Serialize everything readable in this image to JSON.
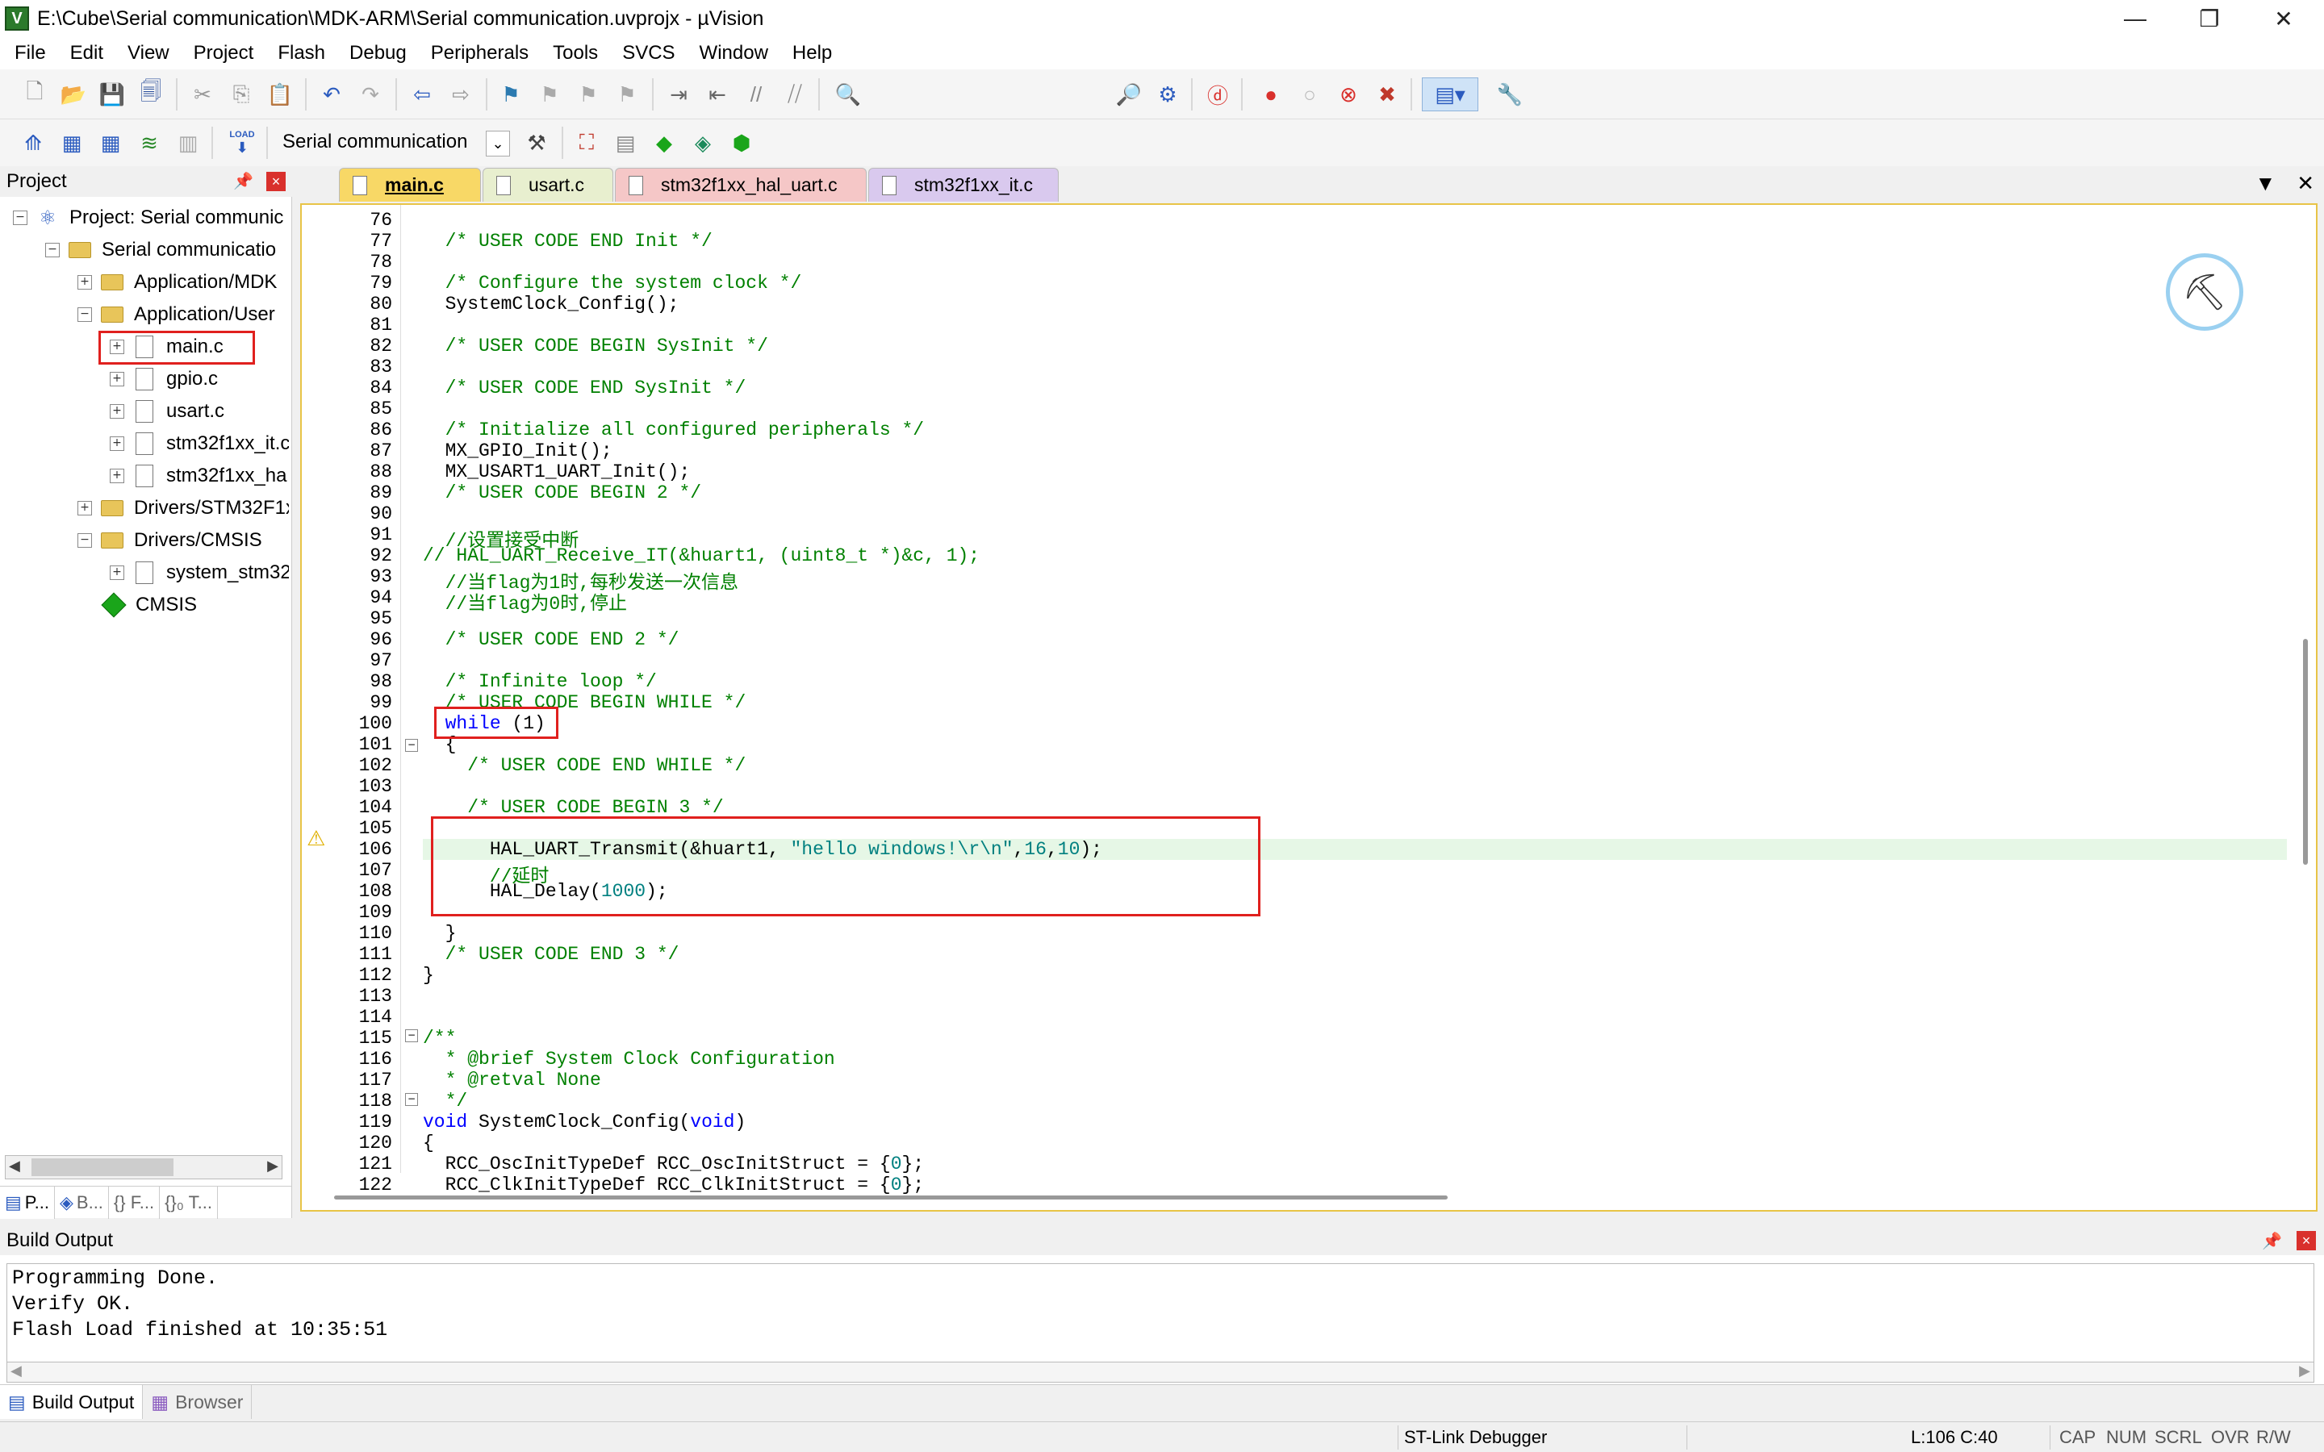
{
  "window": {
    "title": "E:\\Cube\\Serial communication\\MDK-ARM\\Serial communication.uvprojx - µVision",
    "app_icon": "V",
    "controls": {
      "minimize": "—",
      "restore": "❐",
      "close": "✕"
    }
  },
  "menu": [
    "File",
    "Edit",
    "View",
    "Project",
    "Flash",
    "Debug",
    "Peripherals",
    "Tools",
    "SVCS",
    "Window",
    "Help"
  ],
  "toolbar2": {
    "target": "Serial communication",
    "load_label": "LOAD"
  },
  "project_panel": {
    "title": "Project",
    "pin": "📌",
    "close": "×",
    "tree": [
      {
        "label": "Project: Serial communic",
        "expand": "−"
      },
      {
        "label": "Serial communicatio",
        "expand": "−"
      },
      {
        "label": "Application/MDK",
        "expand": "+"
      },
      {
        "label": "Application/User",
        "expand": "−"
      },
      {
        "label": "main.c",
        "expand": "+"
      },
      {
        "label": "gpio.c",
        "expand": "+"
      },
      {
        "label": "usart.c",
        "expand": "+"
      },
      {
        "label": "stm32f1xx_it.c",
        "expand": "+"
      },
      {
        "label": "stm32f1xx_ha",
        "expand": "+"
      },
      {
        "label": "Drivers/STM32F1x",
        "expand": "+"
      },
      {
        "label": "Drivers/CMSIS",
        "expand": "−"
      },
      {
        "label": "system_stm32",
        "expand": "+"
      },
      {
        "label": "CMSIS",
        "expand": ""
      }
    ],
    "tabs": [
      "P...",
      "B...",
      "{} F...",
      "{}₀ T..."
    ]
  },
  "editor": {
    "tabs": [
      {
        "label": "main.c",
        "color": "#f8d866"
      },
      {
        "label": "usart.c",
        "color": "#e8efcf"
      },
      {
        "label": "stm32f1xx_hal_uart.c",
        "color": "#f5c7c7"
      },
      {
        "label": "stm32f1xx_it.c",
        "color": "#d9c9ee"
      }
    ],
    "tab_controls": {
      "dropdown": "▼",
      "close": "✕"
    },
    "warning_icon": "⚠",
    "lines": [
      {
        "n": "76",
        "html": ""
      },
      {
        "n": "77",
        "html": "  <span class=\"cm\">/* USER CODE END Init */</span>"
      },
      {
        "n": "78",
        "html": ""
      },
      {
        "n": "79",
        "html": "  <span class=\"cm\">/* Configure the system clock */</span>"
      },
      {
        "n": "80",
        "html": "  SystemClock_Config();"
      },
      {
        "n": "81",
        "html": ""
      },
      {
        "n": "82",
        "html": "  <span class=\"cm\">/* USER CODE BEGIN SysInit */</span>"
      },
      {
        "n": "83",
        "html": ""
      },
      {
        "n": "84",
        "html": "  <span class=\"cm\">/* USER CODE END SysInit */</span>"
      },
      {
        "n": "85",
        "html": ""
      },
      {
        "n": "86",
        "html": "  <span class=\"cm\">/* Initialize all configured peripherals */</span>"
      },
      {
        "n": "87",
        "html": "  MX_GPIO_Init();"
      },
      {
        "n": "88",
        "html": "  MX_USART1_UART_Init();"
      },
      {
        "n": "89",
        "html": "  <span class=\"cm\">/* USER CODE BEGIN 2 */</span>"
      },
      {
        "n": "90",
        "html": ""
      },
      {
        "n": "91",
        "html": "  <span class=\"cm\">//设置接受中断</span>"
      },
      {
        "n": "92",
        "html": "<span class=\"cm\">// HAL_UART_Receive_IT(&amp;huart1, (uint8_t *)&amp;c, 1);</span>"
      },
      {
        "n": "93",
        "html": "  <span class=\"cm\">//当flag为1时,每秒发送一次信息</span>"
      },
      {
        "n": "94",
        "html": "  <span class=\"cm\">//当flag为0时,停止</span>"
      },
      {
        "n": "95",
        "html": ""
      },
      {
        "n": "96",
        "html": "  <span class=\"cm\">/* USER CODE END 2 */</span>"
      },
      {
        "n": "97",
        "html": ""
      },
      {
        "n": "98",
        "html": "  <span class=\"cm\">/* Infinite loop */</span>"
      },
      {
        "n": "99",
        "html": "  <span class=\"cm\">/* USER CODE BEGIN WHILE */</span>"
      },
      {
        "n": "100",
        "html": "  <span class=\"kw\">while</span> (1)"
      },
      {
        "n": "101",
        "html": "  {"
      },
      {
        "n": "102",
        "html": "    <span class=\"cm\">/* USER CODE END WHILE */</span>"
      },
      {
        "n": "103",
        "html": ""
      },
      {
        "n": "104",
        "html": "    <span class=\"cm\">/* USER CODE BEGIN 3 */</span>"
      },
      {
        "n": "105",
        "html": ""
      },
      {
        "n": "106",
        "html": "      HAL_UART_Transmit(&amp;huart1, <span class=\"str\">\"hello windows!\\r\\n\"</span>,<span class=\"num\">16</span>,<span class=\"num\">10</span>);"
      },
      {
        "n": "107",
        "html": "      <span class=\"cm\">//延时</span>"
      },
      {
        "n": "108",
        "html": "      HAL_Delay(<span class=\"num\">1000</span>);"
      },
      {
        "n": "109",
        "html": ""
      },
      {
        "n": "110",
        "html": "  }"
      },
      {
        "n": "111",
        "html": "  <span class=\"cm\">/* USER CODE END 3 */</span>"
      },
      {
        "n": "112",
        "html": "}"
      },
      {
        "n": "113",
        "html": ""
      },
      {
        "n": "114",
        "html": ""
      },
      {
        "n": "115",
        "html": "<span class=\"cm\">/**</span>"
      },
      {
        "n": "116",
        "html": "<span class=\"cm\">  * @brief System Clock Configuration</span>"
      },
      {
        "n": "117",
        "html": "<span class=\"cm\">  * @retval None</span>"
      },
      {
        "n": "118",
        "html": "<span class=\"cm\">  */</span>"
      },
      {
        "n": "119",
        "html": "<span class=\"kw\">void</span> SystemClock_Config(<span class=\"kw\">void</span>)"
      },
      {
        "n": "120",
        "html": "{"
      },
      {
        "n": "121",
        "html": "  RCC_OscInitTypeDef RCC_OscInitStruct = {<span class=\"num\">0</span>};"
      },
      {
        "n": "122",
        "html": "  RCC_ClkInitTypeDef RCC_ClkInitStruct = {<span class=\"num\">0</span>};"
      }
    ]
  },
  "build_output": {
    "title": "Build Output",
    "lines": [
      "Programming Done.",
      "Verify OK.",
      "Flash Load finished at 10:35:51"
    ]
  },
  "bottom_tabs": [
    "Build Output",
    "Browser"
  ],
  "status": {
    "debugger": "ST-Link Debugger",
    "position": "L:106 C:40",
    "caps": "CAP",
    "num": "NUM",
    "scrl": "SCRL",
    "ovr": "OVR",
    "rw": "R/W"
  }
}
